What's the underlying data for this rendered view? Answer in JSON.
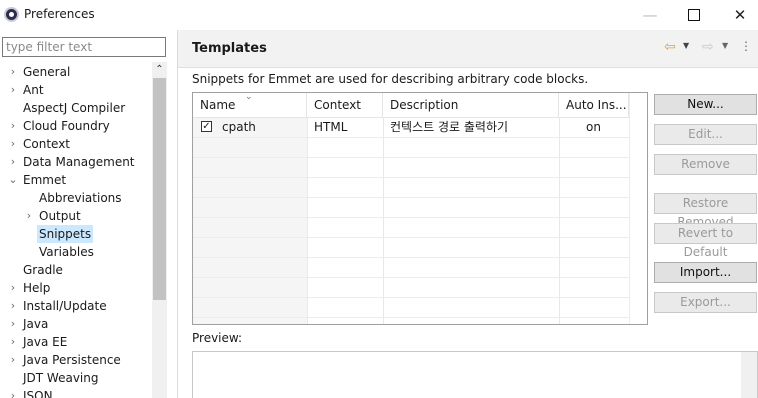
{
  "window": {
    "title": "Preferences"
  },
  "filter": {
    "placeholder": "type filter text"
  },
  "tree": {
    "items": [
      {
        "label": "General",
        "arrow": "›"
      },
      {
        "label": "Ant",
        "arrow": "›"
      },
      {
        "label": "AspectJ Compiler",
        "arrow": ""
      },
      {
        "label": "Cloud Foundry",
        "arrow": "›"
      },
      {
        "label": "Context",
        "arrow": "›"
      },
      {
        "label": "Data Management",
        "arrow": "›"
      },
      {
        "label": "Emmet",
        "arrow": "⌄"
      },
      {
        "label": "Abbreviations",
        "arrow": ""
      },
      {
        "label": "Output",
        "arrow": "›"
      },
      {
        "label": "Snippets",
        "arrow": "",
        "selected": true
      },
      {
        "label": "Variables",
        "arrow": ""
      },
      {
        "label": "Gradle",
        "arrow": ""
      },
      {
        "label": "Help",
        "arrow": "›"
      },
      {
        "label": "Install/Update",
        "arrow": "›"
      },
      {
        "label": "Java",
        "arrow": "›"
      },
      {
        "label": "Java EE",
        "arrow": "›"
      },
      {
        "label": "Java Persistence",
        "arrow": "›"
      },
      {
        "label": "JDT Weaving",
        "arrow": ""
      },
      {
        "label": "JSON",
        "arrow": "›"
      }
    ]
  },
  "page": {
    "title": "Templates",
    "description": "Snippets for Emmet are used for describing arbitrary code blocks."
  },
  "table": {
    "headers": [
      "Name",
      "Context",
      "Description",
      "Auto Ins..."
    ],
    "rows": [
      {
        "checked": true,
        "name": "cpath",
        "context": "HTML",
        "description": "컨텍스트 경로 출력하기",
        "auto_insert": "on"
      }
    ]
  },
  "buttons": {
    "new": "New...",
    "edit": "Edit...",
    "remove": "Remove",
    "restore_removed": "Restore Removed",
    "revert_default": "Revert to Default",
    "import": "Import...",
    "export": "Export..."
  },
  "preview": {
    "label": "Preview:"
  }
}
